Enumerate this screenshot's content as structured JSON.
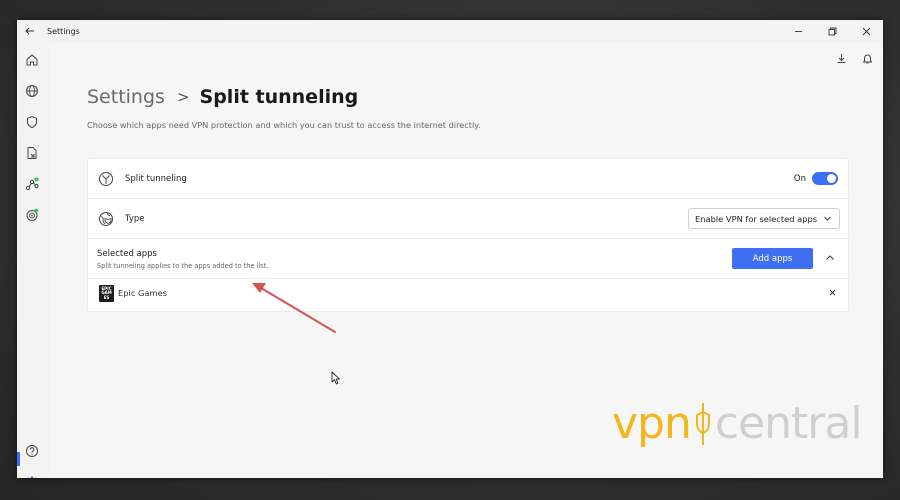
{
  "window": {
    "title": "Settings"
  },
  "sidebar": {
    "items": [
      {
        "icon": "home-icon"
      },
      {
        "icon": "globe-icon"
      },
      {
        "icon": "shield-icon"
      },
      {
        "icon": "split-tunneling-icon"
      },
      {
        "icon": "meshnet-icon"
      },
      {
        "icon": "threat-protection-icon"
      }
    ],
    "bottom_items": [
      {
        "icon": "help-icon"
      },
      {
        "icon": "settings-gear-icon"
      }
    ]
  },
  "toolbar": {
    "icons": [
      "download-icon",
      "notification-bell-icon"
    ]
  },
  "breadcrumb": {
    "root": "Settings",
    "separator": ">",
    "current": "Split tunneling"
  },
  "subtitle": "Choose which apps need VPN protection and which you can trust to access the internet directly.",
  "split_tunneling": {
    "label": "Split tunneling",
    "state_label": "On",
    "enabled": true
  },
  "type": {
    "label": "Type",
    "selected": "Enable VPN for selected apps"
  },
  "selected_apps": {
    "title": "Selected apps",
    "description": "Split tunneling applies to the apps added to the list.",
    "add_button": "Add apps",
    "apps": [
      {
        "name": "Epic Games",
        "logo_text": "EPIC GAMES"
      }
    ]
  },
  "watermark": {
    "part1": "vpn",
    "part2": "central"
  },
  "colors": {
    "accent": "#3b6ff5",
    "arrow": "#d9534f",
    "watermark_vpn": "#f6b51e",
    "watermark_central": "#cfcfcf"
  }
}
